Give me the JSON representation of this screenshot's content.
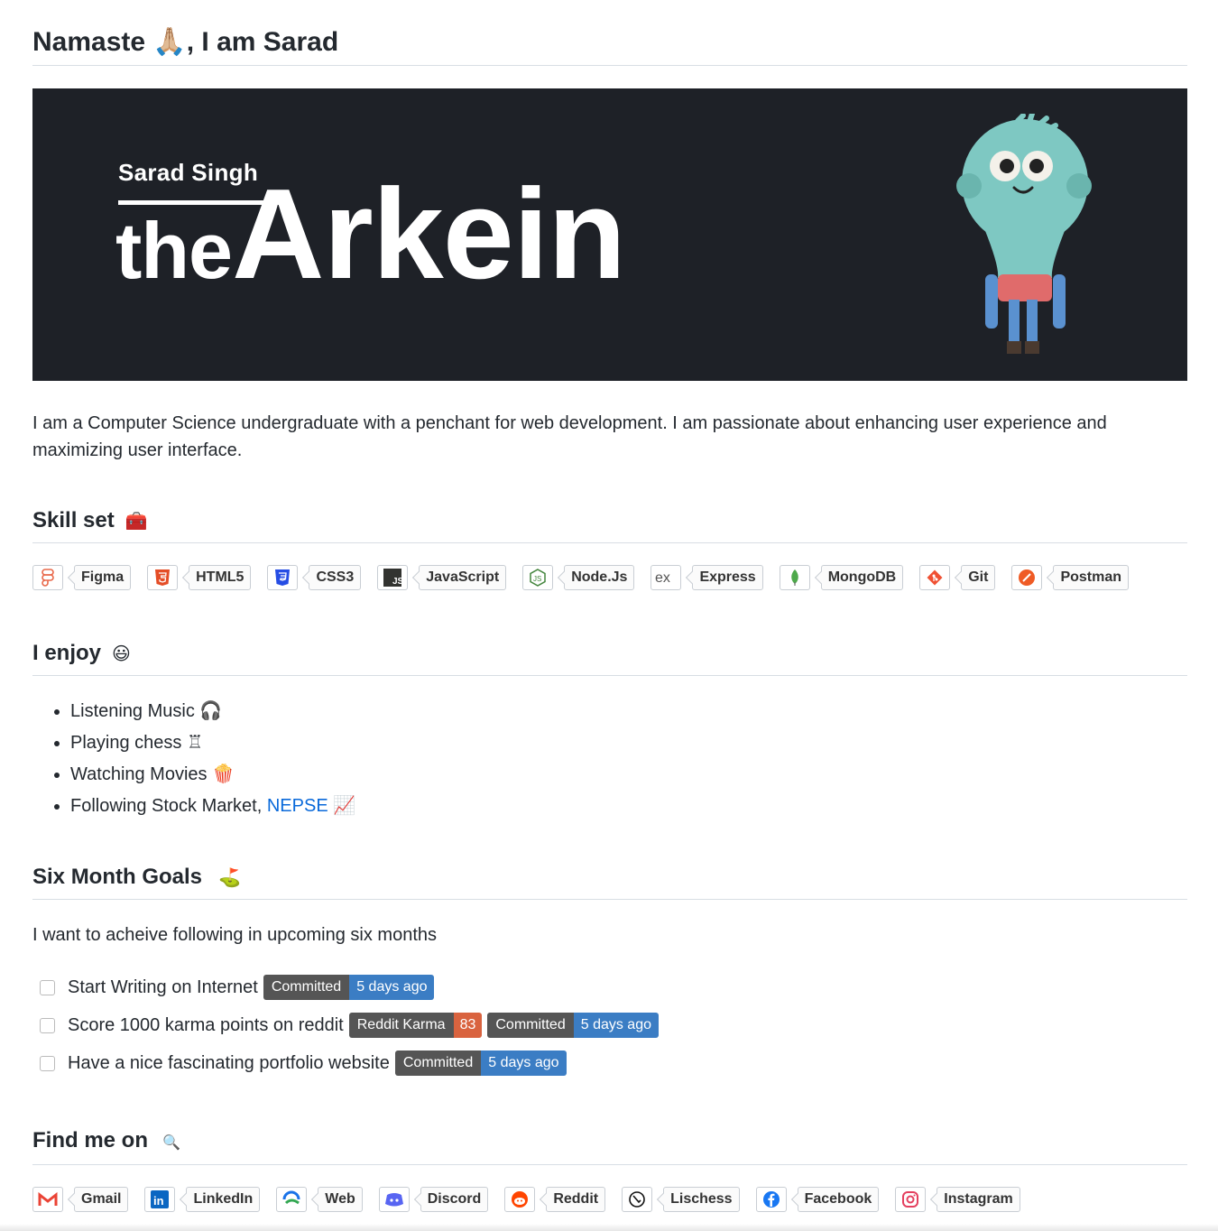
{
  "heading": "Namaste 🙏🏼, I am Sarad",
  "banner": {
    "subtitle": "Sarad Singh",
    "title_small": "the",
    "title_big": "Arkein"
  },
  "intro": "I am a Computer Science undergraduate with a penchant for web development. I am passionate about enhancing user experience and maximizing user interface.",
  "skills": {
    "title": "Skill set",
    "emoji": "🧰",
    "items": [
      "Figma",
      "HTML5",
      "CSS3",
      "JavaScript",
      "Node.Js",
      "Express",
      "MongoDB",
      "Git",
      "Postman"
    ]
  },
  "enjoy": {
    "title": "I enjoy",
    "emoji": "😃",
    "items": [
      {
        "text": "Listening Music",
        "emoji": "🎧"
      },
      {
        "text": "Playing chess",
        "emoji": "♖"
      },
      {
        "text": "Watching Movies",
        "emoji": "🍿"
      },
      {
        "text": "Following Stock Market,",
        "link": "NEPSE",
        "emoji": "📈"
      }
    ]
  },
  "goals": {
    "title": "Six Month Goals",
    "emoji": "⛳",
    "intro": "I want to acheive following in upcoming six months",
    "tasks": [
      {
        "text": "Start Writing on Internet",
        "committed": "Committed",
        "when": "5 days ago"
      },
      {
        "text": "Score 1000 karma points on reddit",
        "karma_label": "Reddit Karma",
        "karma_value": "83",
        "committed": "Committed",
        "when": "5 days ago"
      },
      {
        "text": "Have a nice fascinating portfolio website",
        "committed": "Committed",
        "when": "5 days ago"
      }
    ]
  },
  "findme": {
    "title": "Find me on",
    "emoji": "🔍",
    "items": [
      "Gmail",
      "LinkedIn",
      "Web",
      "Discord",
      "Reddit",
      "Lischess",
      "Facebook",
      "Instagram"
    ]
  },
  "colors": {
    "banner_bg": "#1e2127",
    "bulb": "#7ec8c2",
    "link": "#0969da",
    "shield_left": "#555555",
    "shield_blue": "#3b7dc4",
    "shield_orange": "#d9633f"
  }
}
